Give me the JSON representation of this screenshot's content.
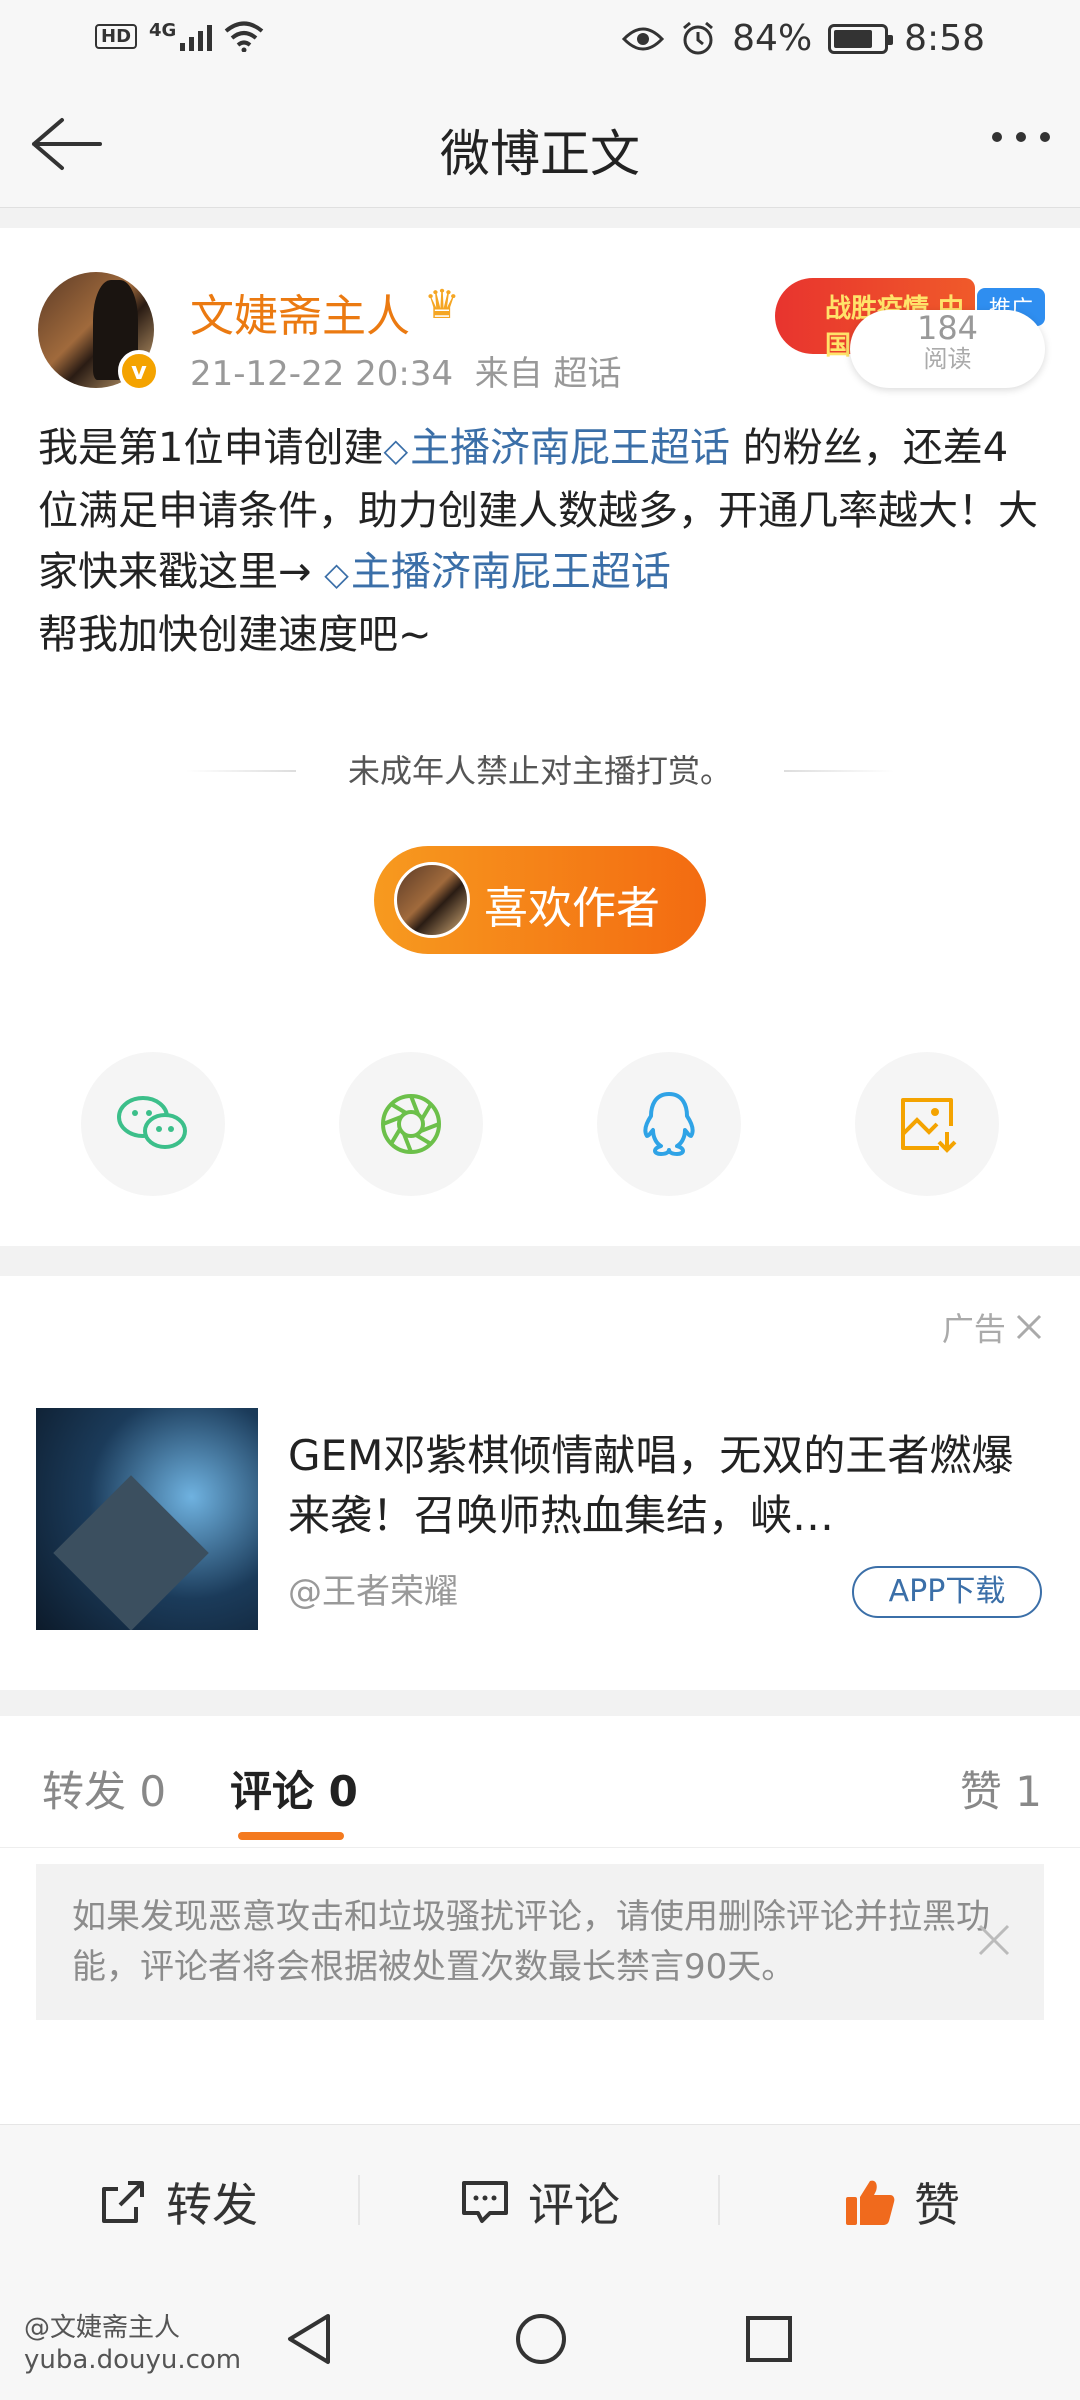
{
  "status_bar": {
    "hd": "HD",
    "network": "4G",
    "battery": "84%",
    "time": "8:58"
  },
  "nav": {
    "title": "微博正文",
    "back_icon": "arrow-left-icon",
    "more_icon": "more-dots-icon"
  },
  "post": {
    "author": "文婕斋主人",
    "timestamp": "21-12-22 20:34",
    "source": "来自 超话",
    "promo_badge": "战胜疫情 中国",
    "promo_tag": "推广",
    "read_count": "184",
    "read_label": "阅读",
    "content_1": "我是第1位申请创建",
    "topic": "主播济南屁王超话",
    "content_2": " 的粉丝，还差4位满足申请条件，助力创建人数越多，开通几率越大！大家快来戳这里→ ",
    "content_3": "帮我加快创建速度吧~",
    "notice": "未成年人禁止对主播打赏。",
    "like_author": "喜欢作者",
    "share_icons": [
      "wechat-icon",
      "moments-icon",
      "qq-icon",
      "save-image-icon"
    ]
  },
  "ad": {
    "label": "广告",
    "title": "GEM邓紫棋倾情献唱，无双的王者燃爆来袭！召唤师热血集结，峡…",
    "source": "@王者荣耀",
    "download": "APP下载"
  },
  "tabs": {
    "repost": "转发 0",
    "comment": "评论 0",
    "like": "赞 1"
  },
  "comment_tip": "如果发现恶意攻击和垃圾骚扰评论，请使用删除评论并拉黑功能，评论者将会根据被处置次数最长禁言90天。",
  "actions": {
    "repost": "转发",
    "comment": "评论",
    "like": "赞"
  },
  "watermark": {
    "line1": "@文婕斋主人",
    "line2": "yuba.douyu.com"
  },
  "colors": {
    "accent": "#f47a1f",
    "link": "#3b6fa8",
    "author": "#eb7a11"
  }
}
